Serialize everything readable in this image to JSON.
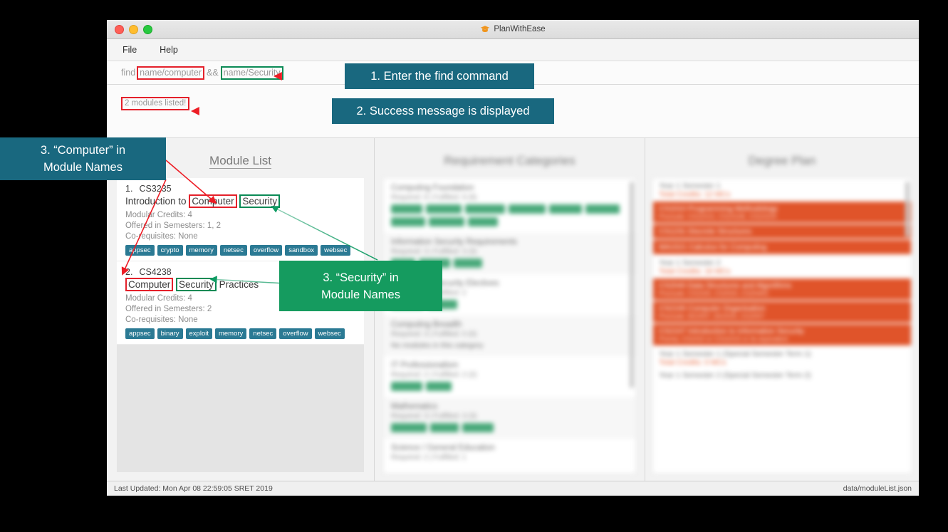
{
  "window": {
    "title": "PlanWithEase",
    "icon": "graduation-cap-icon",
    "traffic_lights": [
      "close",
      "minimize",
      "zoom"
    ]
  },
  "menubar": {
    "items": [
      {
        "label": "File"
      },
      {
        "label": "Help"
      }
    ]
  },
  "command": {
    "prefix": "find",
    "term1": "name/computer",
    "operator": "&&",
    "term2": "name/Security",
    "full_text": "find name/computer && name/Security"
  },
  "result": {
    "message": "2 modules listed!"
  },
  "panels": {
    "module_list": {
      "title": "Module List",
      "modules": [
        {
          "index": "1.",
          "code": "CS3235",
          "name_prefix": "Introduction to ",
          "name_hl_red": "Computer",
          "name_gap": " ",
          "name_hl_green": "Security",
          "name_suffix": "",
          "credits": "Modular Credits: 4",
          "semesters": "Offered in Semesters: 1, 2",
          "coreqs": "Co-requisites: None",
          "tags": [
            "appsec",
            "crypto",
            "memory",
            "netsec",
            "overflow",
            "sandbox",
            "websec"
          ]
        },
        {
          "index": "2.",
          "code": "CS4238",
          "name_prefix": "",
          "name_hl_red": "Computer",
          "name_gap": " ",
          "name_hl_green": "Security",
          "name_suffix": " Practices",
          "credits": "Modular Credits: 4",
          "semesters": "Offered in Semesters: 2",
          "coreqs": "Co-requisites: None",
          "tags": [
            "appsec",
            "binary",
            "exploit",
            "memory",
            "netsec",
            "overflow",
            "websec"
          ]
        }
      ]
    },
    "requirement_categories": {
      "title": "Requirement Categories",
      "blurred": true,
      "categories": [
        {
          "name": "Computing Foundation",
          "sub": "Required: 9 | Fulfilled: 9 (9)",
          "tag_widths": [
            44,
            50,
            56,
            52,
            46,
            48,
            48,
            50,
            42
          ],
          "none": false
        },
        {
          "name": "Information Security Requirements",
          "sub": "Required: 3 | Fulfilled: 3 (3)",
          "tag_widths": [
            34,
            44,
            40
          ],
          "none": false
        },
        {
          "name": "Information Security Electives",
          "sub": "Required: 2 | Fulfilled: 2",
          "tag_widths": [
            46,
            42
          ],
          "none": false
        },
        {
          "name": "Computing Breadth",
          "sub": "Required: 3 | Fulfilled: 0 (0)",
          "tag_widths": [],
          "none": true,
          "none_text": "No modules in this category"
        },
        {
          "name": "IT Professionalism",
          "sub": "Required: 2 | Fulfilled: 2 (2)",
          "tag_widths": [
            44,
            36
          ],
          "none": false
        },
        {
          "name": "Mathematics",
          "sub": "Required: 3 | Fulfilled: 3 (3)",
          "tag_widths": [
            50,
            40,
            44
          ],
          "none": false
        },
        {
          "name": "Science / General Education",
          "sub": "Required: 2 | Fulfilled: 1",
          "tag_widths": [],
          "none": false
        }
      ]
    },
    "degree_plan": {
      "title": "Degree Plan",
      "blurred": true,
      "semesters": [
        {
          "header": "Year 1 Semester 1",
          "credits": "Total Credits: 12 MCs",
          "modules": [
            {
              "title": "CS1010 Programming Methodology",
              "sub": "Preclude: CS1101S, CS1010E, CS1010X"
            },
            {
              "title": "CS1231 Discrete Structures",
              "sub": ""
            },
            {
              "title": "MA1521 Calculus for Computing",
              "sub": ""
            }
          ]
        },
        {
          "header": "Year 1 Semester 2",
          "credits": "Total Credits: 16 MCs",
          "modules": [
            {
              "title": "CS2040 Data Structures and Algorithms",
              "sub": "Preclude: CS1020, CS2020, CS2040C"
            },
            {
              "title": "CS2100 Computer Organisation",
              "sub": "Preclude: EE2007, EE2020, CG2007"
            },
            {
              "title": "CS2107 Introduction to Information Security",
              "sub": "Prereq: CS1010 or CS1101S or its equivalent"
            }
          ]
        },
        {
          "header": "Year 1 Semester 1 (Special Semester Term 1)",
          "credits": "Total Credits: 0 MCs",
          "modules": []
        },
        {
          "header": "Year 1 Semester 2 (Special Semester Term 2)",
          "credits": "",
          "modules": []
        }
      ]
    }
  },
  "statusbar": {
    "left": "Last Updated: Mon Apr 08 22:59:05 SRET 2019",
    "right": "data/moduleList.json"
  },
  "annotations": {
    "callouts": [
      {
        "id": "callout-1",
        "text": "1. Enter the find command",
        "color": "#19687f"
      },
      {
        "id": "callout-2",
        "text": "2. Success message is displayed",
        "color": "#19687f"
      },
      {
        "id": "callout-3",
        "text": "3. “Computer” in Module Names",
        "line1": "3. “Computer” in",
        "line2": "Module Names",
        "color": "#19687f"
      },
      {
        "id": "callout-4",
        "text": "3. “Security” in Module Names",
        "line1": "3. “Security” in",
        "line2": "Module Names",
        "color": "#159b5f"
      }
    ],
    "arrow_colors": {
      "red": "#ed1c24",
      "green": "#0f9b63"
    }
  }
}
